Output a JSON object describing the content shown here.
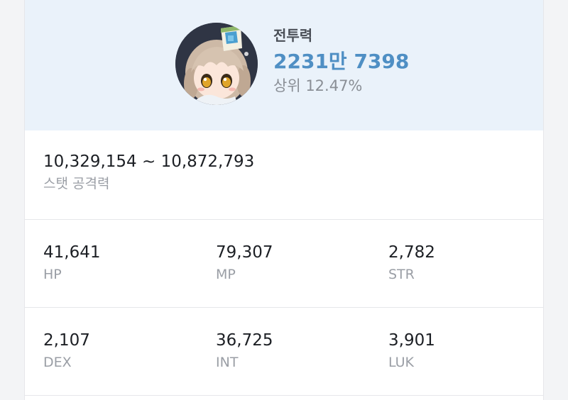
{
  "header": {
    "power_label": "전투력",
    "power_value": "2231만 7398",
    "power_rank": "상위 12.47%",
    "accent_color": "#4f8fc4",
    "background_color": "#eaf2fa"
  },
  "attack": {
    "value": "10,329,154 ~ 10,872,793",
    "label": "스탯 공격력"
  },
  "stats": [
    [
      {
        "value": "41,641",
        "label": "HP"
      },
      {
        "value": "79,307",
        "label": "MP"
      },
      {
        "value": "2,782",
        "label": "STR"
      }
    ],
    [
      {
        "value": "2,107",
        "label": "DEX"
      },
      {
        "value": "36,725",
        "label": "INT"
      },
      {
        "value": "3,901",
        "label": "LUK"
      }
    ]
  ]
}
